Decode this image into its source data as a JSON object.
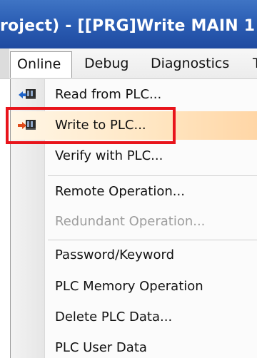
{
  "window": {
    "title": "roject) - [[PRG]Write MAIN 1"
  },
  "menubar": {
    "tabs": [
      {
        "label": "Online"
      },
      {
        "label": "Debug"
      },
      {
        "label": "Diagnostics"
      },
      {
        "label": "T"
      }
    ]
  },
  "online_menu": {
    "items": [
      {
        "label": "Read from PLC...",
        "icon": "read-from-plc-icon",
        "enabled": true
      },
      {
        "label": "Write to PLC...",
        "icon": "write-to-plc-icon",
        "enabled": true,
        "highlighted": true
      },
      {
        "label": "Verify with PLC...",
        "enabled": true
      },
      {
        "label": "Remote Operation...",
        "enabled": true
      },
      {
        "label": "Redundant Operation...",
        "enabled": false
      },
      {
        "label": "Password/Keyword",
        "enabled": true
      },
      {
        "label": "PLC Memory Operation",
        "enabled": true
      },
      {
        "label": "Delete PLC Data...",
        "enabled": true
      },
      {
        "label": "PLC User Data",
        "enabled": true
      }
    ]
  },
  "colors": {
    "title_bar": "#2c5fb5",
    "highlight_frame": "#e8141b",
    "hover_background": "#ffe7c4",
    "disabled_text": "#9d9d9d"
  }
}
